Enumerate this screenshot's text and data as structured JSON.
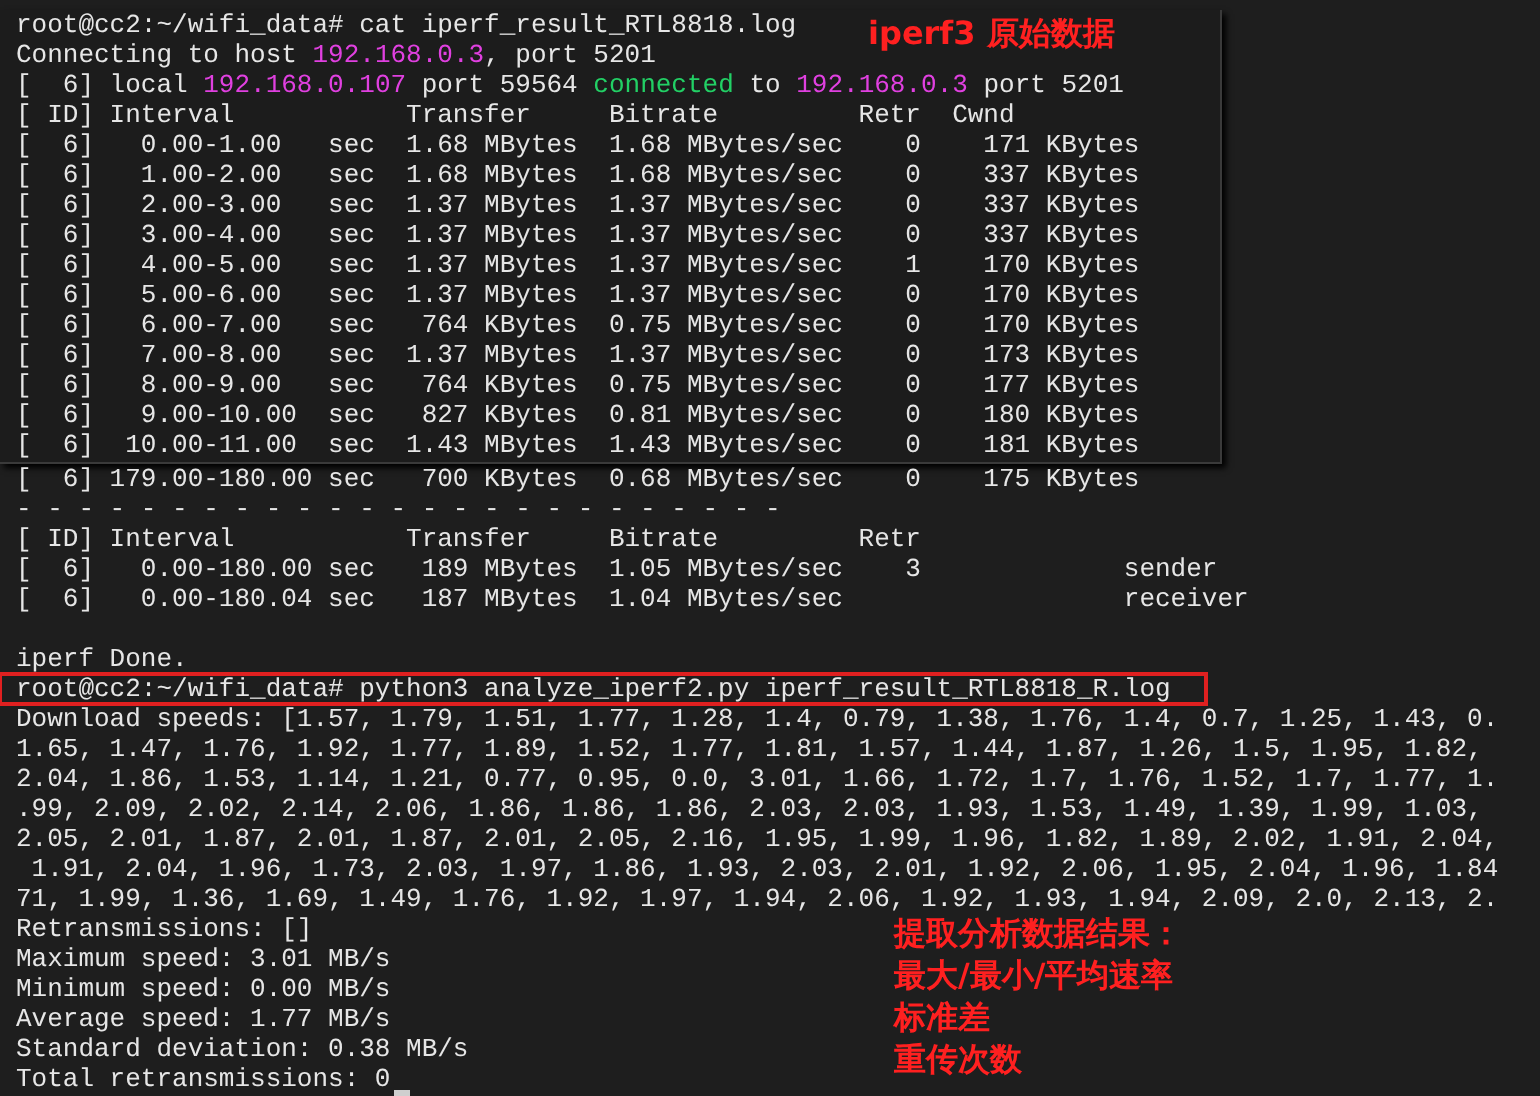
{
  "log_panel": {
    "lines": [
      {
        "kind": "text",
        "segments": [
          {
            "text": "root@cc2:~/wifi_data# cat iperf_result_RTL8818.log",
            "kind": "plain"
          }
        ]
      },
      {
        "kind": "text",
        "segments": [
          {
            "text": "Connecting to host ",
            "kind": "plain"
          },
          {
            "text": "192.168.0.3",
            "kind": "address"
          },
          {
            "text": ", port 5201",
            "kind": "plain"
          }
        ]
      },
      {
        "kind": "text",
        "segments": [
          {
            "text": "[  6] local ",
            "kind": "plain"
          },
          {
            "text": "192.168.0.107",
            "kind": "address"
          },
          {
            "text": " port 59564 ",
            "kind": "plain"
          },
          {
            "text": "connected",
            "kind": "status"
          },
          {
            "text": " to ",
            "kind": "plain"
          },
          {
            "text": "192.168.0.3",
            "kind": "address"
          },
          {
            "text": " port 5201",
            "kind": "plain"
          }
        ]
      },
      {
        "kind": "text",
        "segments": [
          {
            "text": "[ ID] Interval           Transfer     Bitrate         Retr  Cwnd",
            "kind": "plain"
          }
        ]
      },
      {
        "kind": "text",
        "segments": [
          {
            "text": "[  6]   0.00-1.00   sec  1.68 MBytes  1.68 MBytes/sec    0    171 KBytes",
            "kind": "plain"
          }
        ]
      },
      {
        "kind": "text",
        "segments": [
          {
            "text": "[  6]   1.00-2.00   sec  1.68 MBytes  1.68 MBytes/sec    0    337 KBytes",
            "kind": "plain"
          }
        ]
      },
      {
        "kind": "text",
        "segments": [
          {
            "text": "[  6]   2.00-3.00   sec  1.37 MBytes  1.37 MBytes/sec    0    337 KBytes",
            "kind": "plain"
          }
        ]
      },
      {
        "kind": "text",
        "segments": [
          {
            "text": "[  6]   3.00-4.00   sec  1.37 MBytes  1.37 MBytes/sec    0    337 KBytes",
            "kind": "plain"
          }
        ]
      },
      {
        "kind": "text",
        "segments": [
          {
            "text": "[  6]   4.00-5.00   sec  1.37 MBytes  1.37 MBytes/sec    1    170 KBytes",
            "kind": "plain"
          }
        ]
      },
      {
        "kind": "text",
        "segments": [
          {
            "text": "[  6]   5.00-6.00   sec  1.37 MBytes  1.37 MBytes/sec    0    170 KBytes",
            "kind": "plain"
          }
        ]
      },
      {
        "kind": "text",
        "segments": [
          {
            "text": "[  6]   6.00-7.00   sec   764 KBytes  0.75 MBytes/sec    0    170 KBytes",
            "kind": "plain"
          }
        ]
      },
      {
        "kind": "text",
        "segments": [
          {
            "text": "[  6]   7.00-8.00   sec  1.37 MBytes  1.37 MBytes/sec    0    173 KBytes",
            "kind": "plain"
          }
        ]
      },
      {
        "kind": "text",
        "segments": [
          {
            "text": "[  6]   8.00-9.00   sec   764 KBytes  0.75 MBytes/sec    0    177 KBytes",
            "kind": "plain"
          }
        ]
      },
      {
        "kind": "text",
        "segments": [
          {
            "text": "[  6]   9.00-10.00  sec   827 KBytes  0.81 MBytes/sec    0    180 KBytes",
            "kind": "plain"
          }
        ]
      },
      {
        "kind": "text",
        "segments": [
          {
            "text": "[  6]  10.00-11.00  sec  1.43 MBytes  1.43 MBytes/sec    0    181 KBytes",
            "kind": "plain"
          }
        ]
      }
    ]
  },
  "terminal": {
    "lines": [
      {
        "kind": "text",
        "segments": [
          {
            "text": "[  6] 179.00-180.00 sec   700 KBytes  0.68 MBytes/sec    0    175 KBytes",
            "kind": "plain"
          }
        ]
      },
      {
        "kind": "text",
        "segments": [
          {
            "text": "- - - - - - - - - - - - - - - - - - - - - - - - -",
            "kind": "plain"
          }
        ]
      },
      {
        "kind": "text",
        "segments": [
          {
            "text": "[ ID] Interval           Transfer     Bitrate         Retr",
            "kind": "plain"
          }
        ]
      },
      {
        "kind": "text",
        "segments": [
          {
            "text": "[  6]   0.00-180.00 sec   189 MBytes  1.05 MBytes/sec    3             sender",
            "kind": "plain"
          }
        ]
      },
      {
        "kind": "text",
        "segments": [
          {
            "text": "[  6]   0.00-180.04 sec   187 MBytes  1.04 MBytes/sec                  receiver",
            "kind": "plain"
          }
        ]
      },
      {
        "kind": "blank"
      },
      {
        "kind": "text",
        "segments": [
          {
            "text": "iperf Done.",
            "kind": "plain"
          }
        ]
      },
      {
        "kind": "text",
        "boxed": true,
        "segments": [
          {
            "text": "root@cc2:~/wifi_data# python3 analyze_iperf2.py iperf_result_RTL8818_R.log",
            "kind": "plain"
          }
        ]
      },
      {
        "kind": "text",
        "segments": [
          {
            "text": "Download speeds: [1.57, 1.79, 1.51, 1.77, 1.28, 1.4, 0.79, 1.38, 1.76, 1.4, 0.7, 1.25, 1.43, 0.",
            "kind": "plain"
          }
        ]
      },
      {
        "kind": "text",
        "segments": [
          {
            "text": "1.65, 1.47, 1.76, 1.92, 1.77, 1.89, 1.52, 1.77, 1.81, 1.57, 1.44, 1.87, 1.26, 1.5, 1.95, 1.82,",
            "kind": "plain"
          }
        ]
      },
      {
        "kind": "text",
        "segments": [
          {
            "text": "2.04, 1.86, 1.53, 1.14, 1.21, 0.77, 0.95, 0.0, 3.01, 1.66, 1.72, 1.7, 1.76, 1.52, 1.7, 1.77, 1.",
            "kind": "plain"
          }
        ]
      },
      {
        "kind": "text",
        "segments": [
          {
            "text": ".99, 2.09, 2.02, 2.14, 2.06, 1.86, 1.86, 1.86, 2.03, 2.03, 1.93, 1.53, 1.49, 1.39, 1.99, 1.03,",
            "kind": "plain"
          }
        ]
      },
      {
        "kind": "text",
        "segments": [
          {
            "text": "2.05, 2.01, 1.87, 2.01, 1.87, 2.01, 2.05, 2.16, 1.95, 1.99, 1.96, 1.82, 1.89, 2.02, 1.91, 2.04,",
            "kind": "plain"
          }
        ]
      },
      {
        "kind": "text",
        "segments": [
          {
            "text": " 1.91, 2.04, 1.96, 1.73, 2.03, 1.97, 1.86, 1.93, 2.03, 2.01, 1.92, 2.06, 1.95, 2.04, 1.96, 1.84",
            "kind": "plain"
          }
        ]
      },
      {
        "kind": "text",
        "segments": [
          {
            "text": "71, 1.99, 1.36, 1.69, 1.49, 1.76, 1.92, 1.97, 1.94, 2.06, 1.92, 1.93, 1.94, 2.09, 2.0, 2.13, 2.",
            "kind": "plain"
          }
        ]
      },
      {
        "kind": "text",
        "segments": [
          {
            "text": "Retransmissions: []",
            "kind": "plain"
          }
        ]
      },
      {
        "kind": "text",
        "segments": [
          {
            "text": "Maximum speed: 3.01 MB/s",
            "kind": "plain"
          }
        ]
      },
      {
        "kind": "text",
        "segments": [
          {
            "text": "Minimum speed: 0.00 MB/s",
            "kind": "plain"
          }
        ]
      },
      {
        "kind": "text",
        "segments": [
          {
            "text": "Average speed: 1.77 MB/s",
            "kind": "plain"
          }
        ]
      },
      {
        "kind": "text",
        "segments": [
          {
            "text": "Standard deviation: 0.38 MB/s",
            "kind": "plain"
          }
        ]
      },
      {
        "kind": "text",
        "cursor": true,
        "segments": [
          {
            "text": "Total retransmissions: 0",
            "kind": "plain"
          }
        ]
      }
    ]
  },
  "raw_data_note": "iperf3 原始数据",
  "result_note": [
    "提取分析数据结果：",
    "最大/最小/平均速率",
    "标准差",
    "重传次数"
  ]
}
